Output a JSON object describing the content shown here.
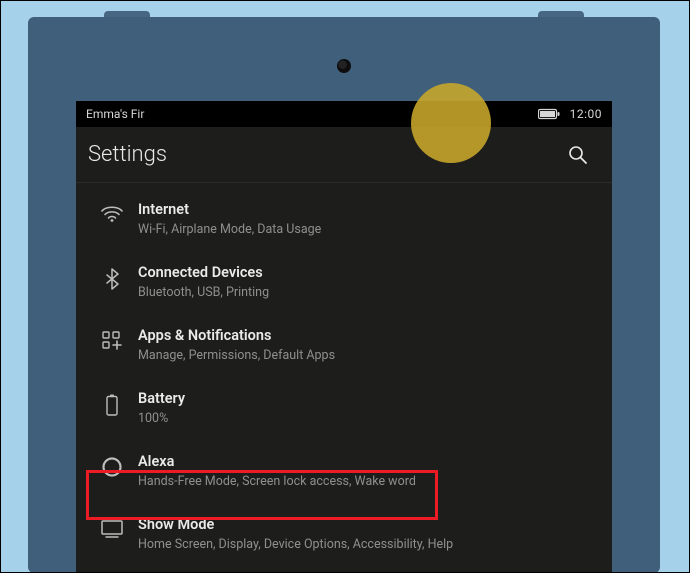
{
  "statusBar": {
    "deviceName": "Emma's Fir",
    "time": "12:00"
  },
  "header": {
    "title": "Settings"
  },
  "rows": [
    {
      "title": "Internet",
      "sub": "Wi-Fi, Airplane Mode, Data Usage"
    },
    {
      "title": "Connected Devices",
      "sub": "Bluetooth, USB, Printing"
    },
    {
      "title": "Apps & Notifications",
      "sub": "Manage, Permissions, Default Apps"
    },
    {
      "title": "Battery",
      "sub": "100%"
    },
    {
      "title": "Alexa",
      "sub": "Hands-Free Mode, Screen lock access, Wake word"
    },
    {
      "title": "Show Mode",
      "sub": "Home Screen, Display, Device Options, Accessibility, Help"
    }
  ],
  "icons": {
    "wifi": "wifi-icon",
    "bluetooth": "bluetooth-icon",
    "apps": "apps-icon",
    "battery": "battery-icon",
    "alexa": "alexa-icon",
    "showmode": "display-icon",
    "search": "search-icon",
    "batteryStatus": "battery-status-icon"
  }
}
